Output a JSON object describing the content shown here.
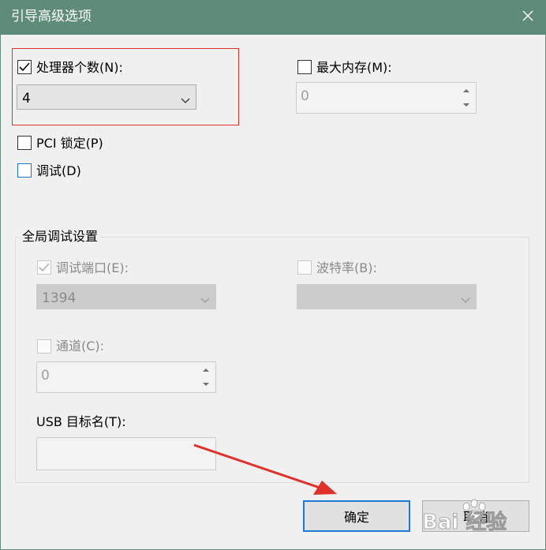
{
  "window": {
    "title": "引导高级选项"
  },
  "options": {
    "processors": {
      "label": "处理器个数(N):",
      "checked": true,
      "value": "4"
    },
    "max_memory": {
      "label": "最大内存(M):",
      "checked": false,
      "value": "0"
    },
    "pci_lock": {
      "label": "PCI 锁定(P)",
      "checked": false
    },
    "debug": {
      "label": "调试(D)",
      "checked": false
    }
  },
  "global_debug": {
    "title": "全局调试设置",
    "debug_port": {
      "label": "调试端口(E):",
      "checked": true,
      "value": "1394"
    },
    "baud_rate": {
      "label": "波特率(B):",
      "checked": false,
      "value": ""
    },
    "channel": {
      "label": "通道(C):",
      "checked": false,
      "value": "0"
    },
    "usb_target": {
      "label": "USB 目标名(T):",
      "value": ""
    }
  },
  "buttons": {
    "ok": "确定",
    "cancel": "取消"
  },
  "watermark": {
    "text": "Bai 经验"
  },
  "colors": {
    "titlebar": "#5e8b7a",
    "highlight": "#e0302a",
    "arrow": "#e0302a",
    "focus": "#1b7ad6"
  },
  "icons": [
    "close-icon",
    "checkmark-icon",
    "chevron-down-icon",
    "spin-up-icon",
    "spin-down-icon",
    "annotation-arrow",
    "baidu-paw-icon"
  ]
}
